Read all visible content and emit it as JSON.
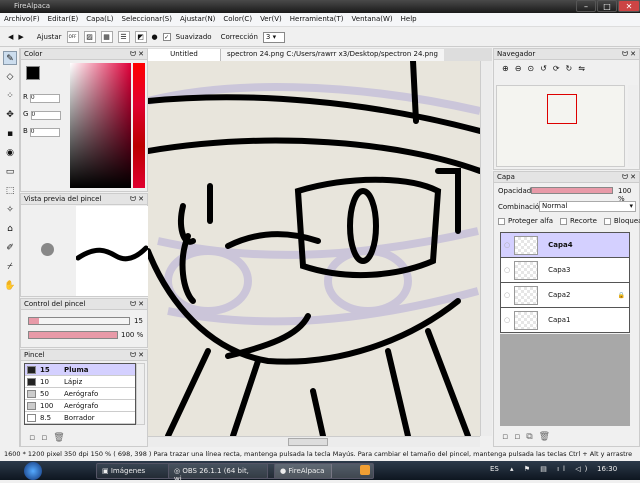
{
  "window": {
    "title": "FireAlpaca",
    "min": "–",
    "max": "□",
    "close": "✕"
  },
  "menu": [
    "Archivo(F)",
    "Editar(E)",
    "Capa(L)",
    "Seleccionar(S)",
    "Ajustar(N)",
    "Color(C)",
    "Ver(V)",
    "Herramienta(T)",
    "Ventana(W)",
    "Help"
  ],
  "toolbar": {
    "prev": "◀",
    "next": "▶",
    "ajustar": "Ajustar",
    "off": "OFF",
    "suavizado": "Suavizado",
    "suavizado_checked": true,
    "correccion": "Corrección",
    "correccion_value": "3"
  },
  "color_panel": {
    "title": "Color",
    "r_label": "R",
    "r": "0",
    "g_label": "G",
    "g": "0",
    "b_label": "B",
    "b": "0",
    "primary": "#000000"
  },
  "preview_panel": {
    "title": "Vista previa del pincel"
  },
  "brush_control": {
    "title": "Control del pincel",
    "size": "15",
    "size_fraction": 0.1,
    "opacity": "100 %",
    "opacity_fraction": 1.0
  },
  "brush_panel": {
    "title": "Pincel",
    "items": [
      {
        "size": "15",
        "name": "Pluma",
        "active": true
      },
      {
        "size": "10",
        "name": "Lápiz"
      },
      {
        "size": "50",
        "name": "Aerógrafo"
      },
      {
        "size": "100",
        "name": "Aerógrafo"
      },
      {
        "size": "8.5",
        "name": "Borrador"
      }
    ]
  },
  "tabs": [
    {
      "label": "Untitled"
    },
    {
      "label": "spectron 24.png   C:/Users/rawrr x3/Desktop/spectron 24.png"
    }
  ],
  "navigator": {
    "title": "Navegador"
  },
  "layer_panel": {
    "title": "Capa",
    "opacity_label": "Opacidad",
    "opacity": "100 %",
    "blend_label": "Combinación",
    "blend": "Normal",
    "protect": "Proteger alfa",
    "clip": "Recorte",
    "lock": "Bloquear",
    "layers": [
      {
        "name": "Capa4",
        "active": true
      },
      {
        "name": "Capa3"
      },
      {
        "name": "Capa2",
        "locked": true
      },
      {
        "name": "Capa1"
      }
    ]
  },
  "status": "1600 * 1200 pixel   350 dpi   150 %   ( 698, 398 )   Para trazar una línea recta, mantenga pulsada la tecla Mayús. Para cambiar el tamaño del pincel, mantenga pulsada las teclas Ctrl + Alt y arrastre",
  "taskbar": {
    "items": [
      "Imágenes",
      "OBS 26.1.1 (64 bit, wi...",
      "FireAlpaca"
    ],
    "lang": "ES",
    "clock": "16:30"
  }
}
